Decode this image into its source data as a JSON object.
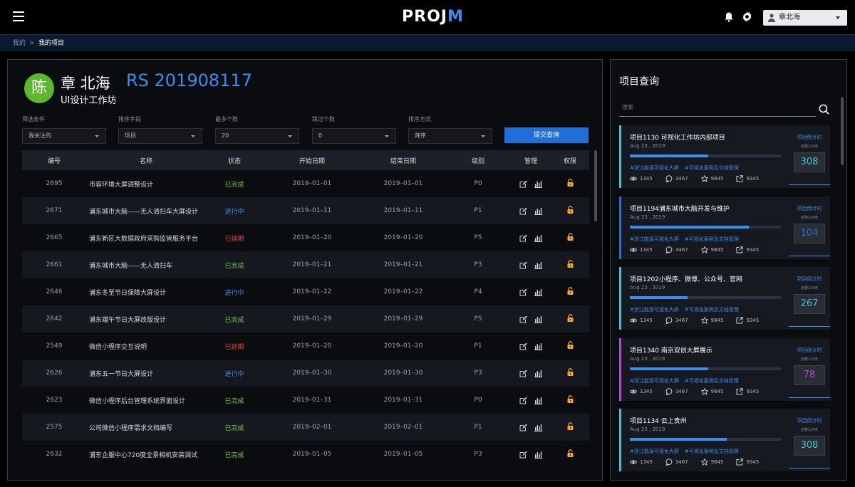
{
  "header": {
    "logo_main": "PROJ",
    "logo_accent": "M",
    "user_name": "章北海"
  },
  "breadcrumb": {
    "home": "我的",
    "separator": ">",
    "current": "我的项目"
  },
  "profile": {
    "avatar_char": "陈",
    "name": "章 北海",
    "studio": "UI设计工作坊",
    "rs_code": "RS 201908117"
  },
  "filters": [
    {
      "label": "筛选条件",
      "value": "我关注的"
    },
    {
      "label": "排序字段",
      "value": "项目"
    },
    {
      "label": "最多个数",
      "value": "20"
    },
    {
      "label": "跳过个数",
      "value": "0"
    },
    {
      "label": "排序方式",
      "value": "降序"
    }
  ],
  "submit_label": "提交查询",
  "table": {
    "headers": [
      "编号",
      "名称",
      "状态",
      "开始日期",
      "结束日期",
      "级别",
      "管理",
      "权限"
    ],
    "rows": [
      {
        "id": "2695",
        "name": "市容环境大屏调整设计",
        "status": "已完成",
        "kind": "done",
        "start": "2019–01–01",
        "end": "2019–01–01",
        "level": "P0"
      },
      {
        "id": "2671",
        "name": "浦东城市大脑——无人清扫车大屏设计",
        "status": "进行中",
        "kind": "prog",
        "start": "2019–01–11",
        "end": "2019–01–11",
        "level": "P1"
      },
      {
        "id": "2665",
        "name": "浦东新区大数据政府采购监管服务平台",
        "status": "已延期",
        "kind": "late",
        "start": "2019–01–20",
        "end": "2019–01–20",
        "level": "P5"
      },
      {
        "id": "2661",
        "name": "浦东城市大脑——无人清扫车",
        "status": "已完成",
        "kind": "done",
        "start": "2019–01–21",
        "end": "2019–01–21",
        "level": "P3"
      },
      {
        "id": "2646",
        "name": "浦东冬至节日保障大屏设计",
        "status": "进行中",
        "kind": "prog",
        "start": "2019–01–22",
        "end": "2019–01–22",
        "level": "P4"
      },
      {
        "id": "2642",
        "name": "浦东端午节日大屏改版设计",
        "status": "已完成",
        "kind": "done",
        "start": "2019–01–29",
        "end": "2019–01–29",
        "level": "P5"
      },
      {
        "id": "2549",
        "name": "微信小程序交互说明",
        "status": "已延期",
        "kind": "late",
        "start": "2019–01–20",
        "end": "2019–01–20",
        "level": "P1"
      },
      {
        "id": "2626",
        "name": "浦东五一节日大屏设计",
        "status": "进行中",
        "kind": "prog",
        "start": "2019–01–30",
        "end": "2019–01–30",
        "level": "P3"
      },
      {
        "id": "2623",
        "name": "微信小程序后台管理系统界面设计",
        "status": "已完成",
        "kind": "done",
        "start": "2019–01–31",
        "end": "2019–01–31",
        "level": "P0"
      },
      {
        "id": "2575",
        "name": "公司微信小程序需求文档编写",
        "status": "已完成",
        "kind": "done",
        "start": "2019–02–01",
        "end": "2019–02–01",
        "level": "P1"
      },
      {
        "id": "2632",
        "name": "浦东企服中心720度全景相机安装调试",
        "status": "已完成",
        "kind": "done",
        "start": "2019–01–05",
        "end": "2019–01–05",
        "level": "P3"
      }
    ]
  },
  "query": {
    "title": "项目查询",
    "search_placeholder": "搜索",
    "countdown_label": "项目倒计时",
    "countdown_sub": "还剩124天",
    "cards": [
      {
        "title": "项目1130  可视化工作坊内部项目",
        "date": "Aug 23 , 2019",
        "progress": 0.52,
        "tag1": "#浙江能源可视化大屏",
        "tag2": "#可视化案例及文档管理",
        "views": "1345",
        "comments": "3467",
        "stars": "9845",
        "shares": "9345",
        "count": "308",
        "accent": "#3ec1d3",
        "count_color": "#3ec1d3"
      },
      {
        "title": "项目1194浦东城市大脑开发与维护",
        "date": "Aug 23 , 2019",
        "progress": 0.79,
        "tag1": "#浙江能源可视化大屏",
        "tag2": "#可视化案例及文档管理",
        "views": "1345",
        "comments": "3467",
        "stars": "9845",
        "shares": "9345",
        "count": "104",
        "accent": "#2c6fd6",
        "count_color": "#2c6fd6"
      },
      {
        "title": "项目1202小程序、微博、公众号、官网",
        "date": "Aug 23 , 2019",
        "progress": 0.38,
        "tag1": "#浙江能源可视化大屏",
        "tag2": "#可视化案例及文档管理",
        "views": "1345",
        "comments": "3467",
        "stars": "9845",
        "shares": "9345",
        "count": "267",
        "accent": "#3ec1d3",
        "count_color": "#3ec1d3"
      },
      {
        "title": "项目1340  南京双创大屏展示",
        "date": "Aug 23 , 2019",
        "progress": 0.52,
        "tag1": "#浙江能源可视化大屏",
        "tag2": "#可视化案例及文档管理",
        "views": "1345",
        "comments": "3467",
        "stars": "9845",
        "shares": "9345",
        "count": "78",
        "accent": "#b24ad6",
        "count_color": "#b24ad6"
      },
      {
        "title": "项目1134  云上贵州",
        "date": "Aug 23 , 2019",
        "progress": 0.64,
        "tag1": "#浙江能源可视化大屏",
        "tag2": "#可视化案例及文档管理",
        "views": "1345",
        "comments": "3467",
        "stars": "9845",
        "shares": "9345",
        "count": "308",
        "accent": "#3ec1d3",
        "count_color": "#3ec1d3"
      }
    ]
  }
}
